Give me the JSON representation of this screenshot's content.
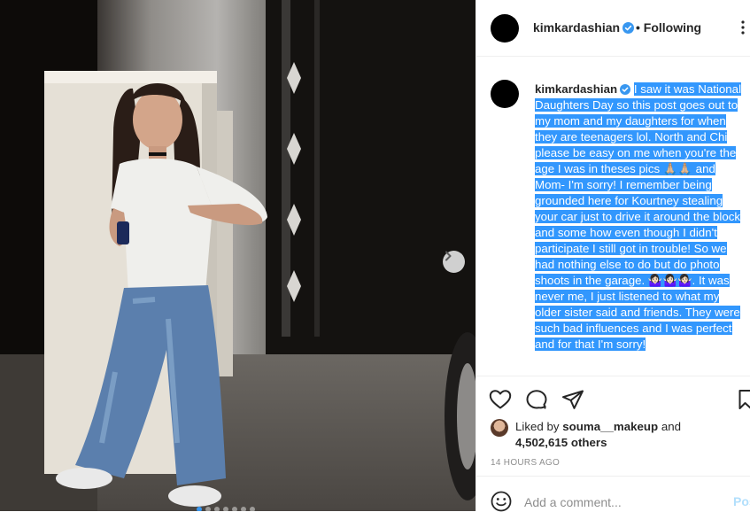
{
  "post": {
    "username": "kimkardashian",
    "follow_status": "• Following",
    "caption_username": "kimkardashian",
    "caption_text": "I saw it was National Daughters Day so this post goes out to my mom and my daughters for when they are teenagers lol. North and Chi please be easy on me when you're the age I was in theses pics 🙏🏼🙏🏼 and Mom- I'm sorry! I remember being grounded here for Kourtney stealing your car just to drive it around the block and some how even though I didn't participate I still got in trouble! So we had nothing else to do but do photo shoots in the garage. 🤷🏻‍♀️🤷🏻‍♀️🤷🏻‍♀️. It was never me, I just listened to what my older sister said and friends. They were such bad influences and I was perfect and for that I'm sorry!",
    "liked_by_prefix": "Liked by",
    "liked_by_user": "souma__makeup",
    "liked_by_and": "and",
    "likes_others": "4,502,615 others",
    "timestamp": "14 HOURS AGO"
  },
  "comment_box": {
    "placeholder": "Add a comment...",
    "post_label": "Post"
  },
  "icons": {
    "verified": "verified-badge-icon",
    "more": "more-options-icon",
    "like": "heart-icon",
    "comment": "comment-bubble-icon",
    "share": "paper-plane-icon",
    "save": "bookmark-icon",
    "emoji": "emoji-smile-icon",
    "next": "chevron-right-icon"
  },
  "colors": {
    "verified_blue": "#3897f0",
    "selection_blue": "#3297fd",
    "post_button_disabled": "#b2dffc",
    "muted_text": "#8e8e8e"
  },
  "carousel": {
    "total_images": 7,
    "current_index": 1
  }
}
